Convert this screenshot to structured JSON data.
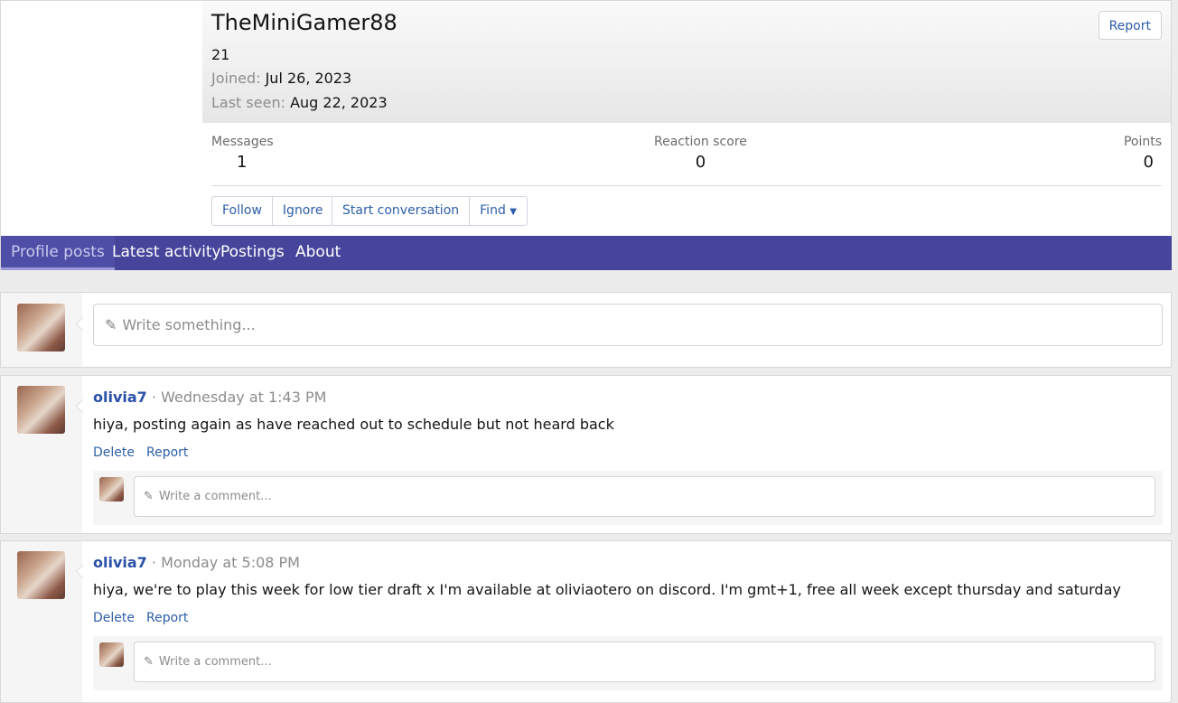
{
  "profile": {
    "username": "TheMiniGamer88",
    "user_title": "21",
    "joined_label": "Joined:",
    "joined_value": "Jul 26, 2023",
    "last_seen_label": "Last seen:",
    "last_seen_value": "Aug 22, 2023",
    "report_label": "Report",
    "stats": {
      "messages_label": "Messages",
      "messages_value": "1",
      "reaction_label": "Reaction score",
      "reaction_value": "0",
      "points_label": "Points",
      "points_value": "0"
    },
    "buttons": {
      "follow": "Follow",
      "ignore": "Ignore",
      "start_conversation": "Start conversation",
      "find": "Find"
    }
  },
  "tabs": [
    "Profile posts",
    "Latest activity",
    "Postings",
    "About"
  ],
  "composer": {
    "placeholder": "Write something..."
  },
  "posts": [
    {
      "author": "olivia7",
      "separator": "·",
      "time": "Wednesday at 1:43 PM",
      "text": "hiya, posting again as have reached out to schedule but not heard back",
      "delete_label": "Delete",
      "report_label": "Report",
      "comment_placeholder": "Write a comment..."
    },
    {
      "author": "olivia7",
      "separator": "·",
      "time": "Monday at 5:08 PM",
      "text": "hiya, we're to play this week for low tier draft x I'm available at oliviaotero on discord. I'm gmt+1, free all week except thursday and saturday",
      "delete_label": "Delete",
      "report_label": "Report",
      "comment_placeholder": "Write a comment..."
    }
  ],
  "icons": {
    "pencil": "pencil-icon",
    "caret": "caret-down-icon"
  },
  "colors": {
    "tab_bar": "#47459b",
    "link": "#2d5ea8",
    "author": "#2a50a8"
  }
}
